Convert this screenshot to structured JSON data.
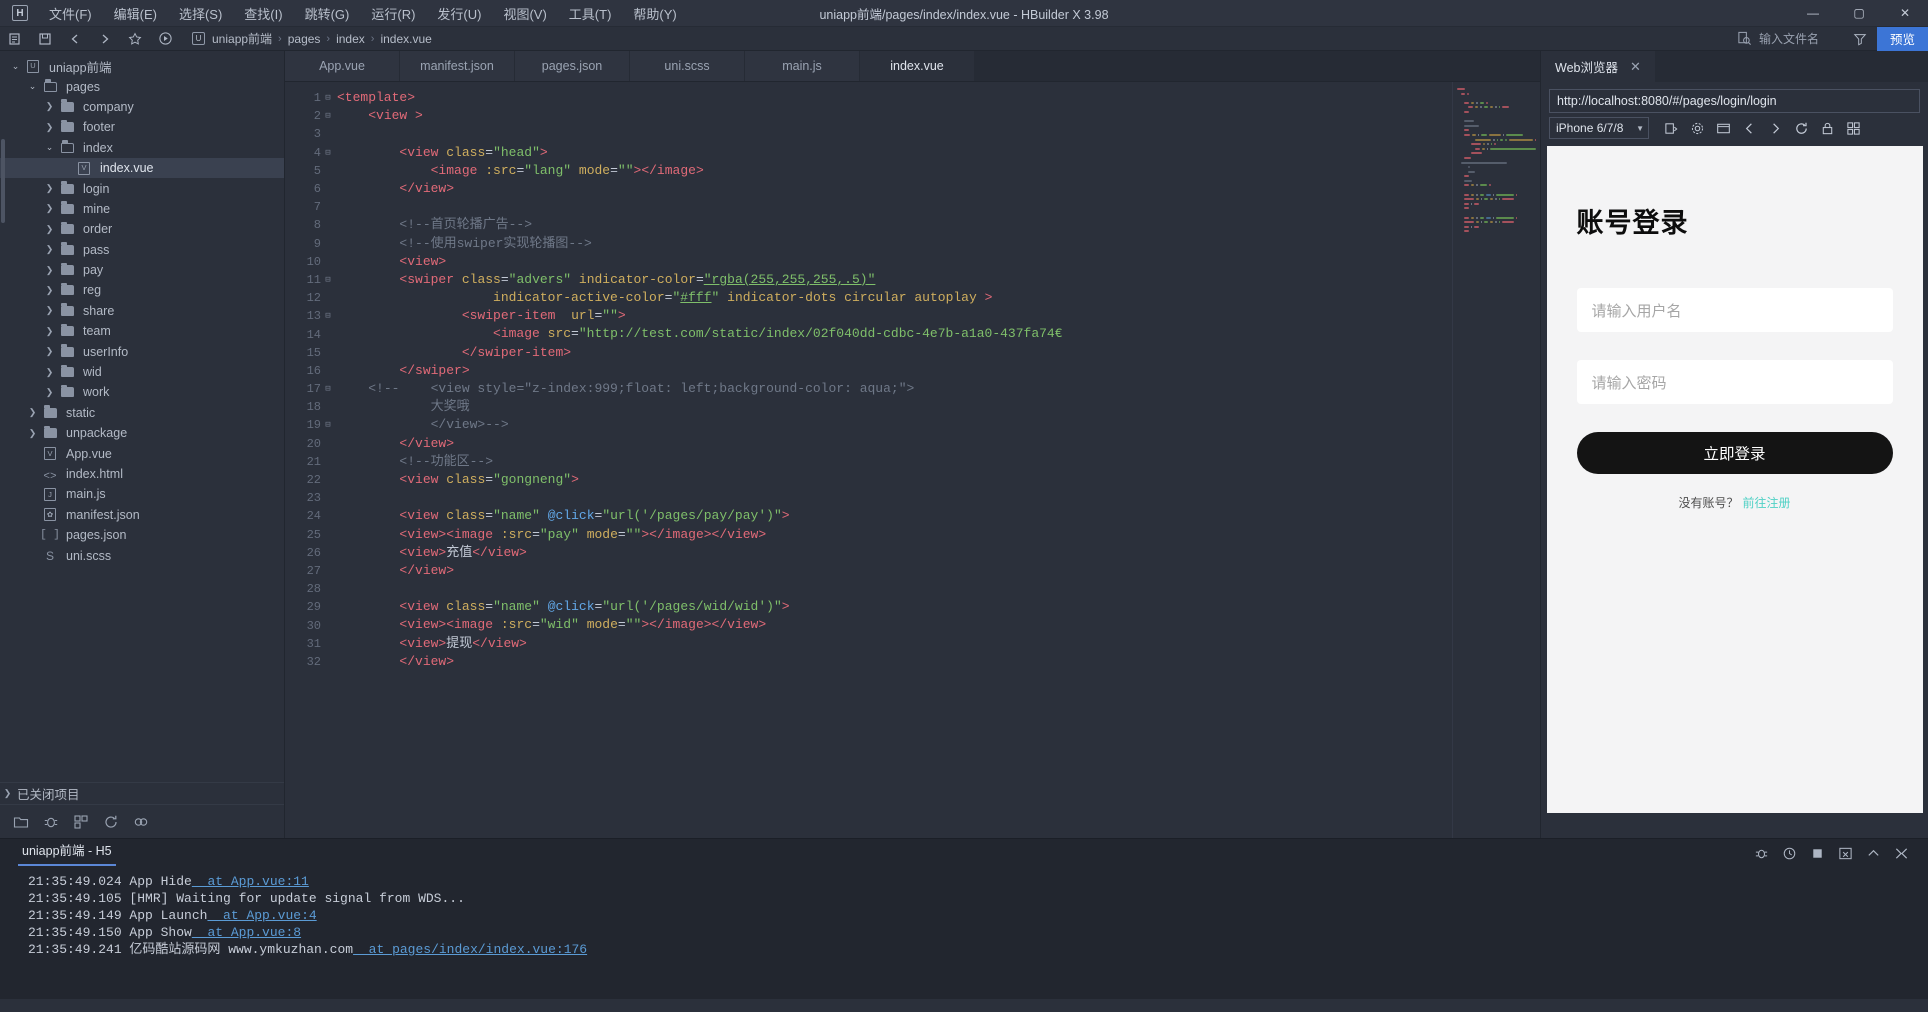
{
  "window": {
    "title": "uniapp前端/pages/index/index.vue - HBuilder X 3.98",
    "logo": "H",
    "minimize": "—",
    "maximize": "▢",
    "close": "✕"
  },
  "menubar": {
    "items": [
      {
        "label": "文件(F)",
        "name": "menu-file"
      },
      {
        "label": "编辑(E)",
        "name": "menu-edit"
      },
      {
        "label": "选择(S)",
        "name": "menu-select"
      },
      {
        "label": "查找(I)",
        "name": "menu-find"
      },
      {
        "label": "跳转(G)",
        "name": "menu-goto"
      },
      {
        "label": "运行(R)",
        "name": "menu-run"
      },
      {
        "label": "发行(U)",
        "name": "menu-publish"
      },
      {
        "label": "视图(V)",
        "name": "menu-view"
      },
      {
        "label": "工具(T)",
        "name": "menu-tools"
      },
      {
        "label": "帮助(Y)",
        "name": "menu-help"
      }
    ]
  },
  "toolbar": {
    "breadcrumb": [
      "uniapp前端",
      "pages",
      "index",
      "index.vue"
    ],
    "breadcrumb_project_icon": "U",
    "file_search_placeholder": "输入文件名",
    "preview_label": "预览",
    "separator": "›"
  },
  "sidebar": {
    "tree": [
      {
        "label": "uniapp前端",
        "depth": 0,
        "caret": "open",
        "icon": "project",
        "selected": false
      },
      {
        "label": "pages",
        "depth": 1,
        "caret": "open",
        "icon": "folder-open",
        "selected": false
      },
      {
        "label": "company",
        "depth": 2,
        "caret": "closed",
        "icon": "folder",
        "selected": false
      },
      {
        "label": "footer",
        "depth": 2,
        "caret": "closed",
        "icon": "folder",
        "selected": false
      },
      {
        "label": "index",
        "depth": 2,
        "caret": "open",
        "icon": "folder-open",
        "selected": false
      },
      {
        "label": "index.vue",
        "depth": 3,
        "caret": "none",
        "icon": "vue",
        "selected": true
      },
      {
        "label": "login",
        "depth": 2,
        "caret": "closed",
        "icon": "folder",
        "selected": false
      },
      {
        "label": "mine",
        "depth": 2,
        "caret": "closed",
        "icon": "folder",
        "selected": false
      },
      {
        "label": "order",
        "depth": 2,
        "caret": "closed",
        "icon": "folder",
        "selected": false
      },
      {
        "label": "pass",
        "depth": 2,
        "caret": "closed",
        "icon": "folder",
        "selected": false
      },
      {
        "label": "pay",
        "depth": 2,
        "caret": "closed",
        "icon": "folder",
        "selected": false
      },
      {
        "label": "reg",
        "depth": 2,
        "caret": "closed",
        "icon": "folder",
        "selected": false
      },
      {
        "label": "share",
        "depth": 2,
        "caret": "closed",
        "icon": "folder",
        "selected": false
      },
      {
        "label": "team",
        "depth": 2,
        "caret": "closed",
        "icon": "folder",
        "selected": false
      },
      {
        "label": "userInfo",
        "depth": 2,
        "caret": "closed",
        "icon": "folder",
        "selected": false
      },
      {
        "label": "wid",
        "depth": 2,
        "caret": "closed",
        "icon": "folder",
        "selected": false
      },
      {
        "label": "work",
        "depth": 2,
        "caret": "closed",
        "icon": "folder",
        "selected": false
      },
      {
        "label": "static",
        "depth": 1,
        "caret": "closed",
        "icon": "folder",
        "selected": false
      },
      {
        "label": "unpackage",
        "depth": 1,
        "caret": "closed",
        "icon": "folder",
        "selected": false
      },
      {
        "label": "App.vue",
        "depth": 1,
        "caret": "none",
        "icon": "vue",
        "selected": false
      },
      {
        "label": "index.html",
        "depth": 1,
        "caret": "none",
        "icon": "html",
        "selected": false
      },
      {
        "label": "main.js",
        "depth": 1,
        "caret": "none",
        "icon": "js",
        "selected": false
      },
      {
        "label": "manifest.json",
        "depth": 1,
        "caret": "none",
        "icon": "cfg",
        "selected": false
      },
      {
        "label": "pages.json",
        "depth": 1,
        "caret": "none",
        "icon": "json",
        "selected": false
      },
      {
        "label": "uni.scss",
        "depth": 1,
        "caret": "none",
        "icon": "scss",
        "selected": false
      }
    ],
    "closed_projects": "已关闭项目",
    "bottom_icons": [
      "explorer-icon",
      "debug-icon",
      "plugin-icon",
      "refresh-icon",
      "sync-icon"
    ]
  },
  "editor": {
    "tabs": [
      {
        "label": "App.vue",
        "active": false
      },
      {
        "label": "manifest.json",
        "active": false
      },
      {
        "label": "pages.json",
        "active": false
      },
      {
        "label": "uni.scss",
        "active": false
      },
      {
        "label": "main.js",
        "active": false
      },
      {
        "label": "index.vue",
        "active": true
      }
    ],
    "lines": [
      {
        "n": 1,
        "fold": "-",
        "html": "<span class=\"tag\">&lt;template&gt;</span>"
      },
      {
        "n": 2,
        "fold": "-",
        "html": "    <span class=\"tag\">&lt;view </span><span class=\"tag\">&gt;</span>"
      },
      {
        "n": 3,
        "fold": "",
        "html": ""
      },
      {
        "n": 4,
        "fold": "-",
        "html": "        <span class=\"tag\">&lt;view </span><span class=\"attr\">class</span><span class=\"plain\">=</span><span class=\"str\">\"head\"</span><span class=\"tag\">&gt;</span>"
      },
      {
        "n": 5,
        "fold": "",
        "html": "            <span class=\"tag\">&lt;image </span><span class=\"attr\">:src</span><span class=\"plain\">=</span><span class=\"str\">\"lang\"</span> <span class=\"attr\">mode</span><span class=\"plain\">=</span><span class=\"str\">\"\"</span><span class=\"tag\">&gt;&lt;/image&gt;</span>"
      },
      {
        "n": 6,
        "fold": "",
        "html": "        <span class=\"tag\">&lt;/view&gt;</span>"
      },
      {
        "n": 7,
        "fold": "",
        "html": ""
      },
      {
        "n": 8,
        "fold": "",
        "html": "        <span class=\"cmt\">&lt;!--首页轮播广告--&gt;</span>"
      },
      {
        "n": 9,
        "fold": "",
        "html": "        <span class=\"cmt\">&lt;!--使用swiper实现轮播图--&gt;</span>"
      },
      {
        "n": 10,
        "fold": "",
        "html": "        <span class=\"tag\">&lt;view&gt;</span>"
      },
      {
        "n": 11,
        "fold": "-",
        "html": "        <span class=\"tag\">&lt;swiper </span><span class=\"attr\">class</span><span class=\"plain\">=</span><span class=\"str\">\"advers\"</span> <span class=\"attr\">indicator-color</span><span class=\"plain\">=</span><span class=\"str ul\">\"rgba(255,255,255,.5)\"</span>"
      },
      {
        "n": 12,
        "fold": "",
        "html": "                    <span class=\"attr\">indicator-active-color</span><span class=\"plain\">=</span><span class=\"str\">\"</span><span class=\"str ul\">#fff</span><span class=\"str\">\"</span> <span class=\"attr\">indicator-dots circular autoplay</span> <span class=\"tag\">&gt;</span>"
      },
      {
        "n": 13,
        "fold": "-",
        "html": "                <span class=\"tag\">&lt;swiper-item </span> <span class=\"attr\">url</span><span class=\"plain\">=</span><span class=\"str\">\"\"</span><span class=\"tag\">&gt;</span>"
      },
      {
        "n": 14,
        "fold": "",
        "html": "                    <span class=\"tag\">&lt;image </span><span class=\"attr\">src</span><span class=\"plain\">=</span><span class=\"str\">\"http://test.com/static/index/02f040dd-cdbc-4e7b-a1a0-437fa74€</span>"
      },
      {
        "n": 15,
        "fold": "",
        "html": "                <span class=\"tag\">&lt;/swiper-item&gt;</span>"
      },
      {
        "n": 16,
        "fold": "",
        "html": "        <span class=\"tag\">&lt;/swiper&gt;</span>"
      },
      {
        "n": 17,
        "fold": "-",
        "html": "    <span class=\"cmt\">&lt;!--    &lt;view style=\"z-index:999;float: left;background-color: aqua;\"&gt;</span>"
      },
      {
        "n": 18,
        "fold": "",
        "html": "            <span class=\"cmt\">大奖哦</span>"
      },
      {
        "n": 19,
        "fold": "-",
        "html": "            <span class=\"cmt\">&lt;/view&gt;--&gt;</span>"
      },
      {
        "n": 20,
        "fold": "",
        "html": "        <span class=\"tag\">&lt;/view&gt;</span>"
      },
      {
        "n": 21,
        "fold": "",
        "html": "        <span class=\"cmt\">&lt;!--功能区--&gt;</span>"
      },
      {
        "n": 22,
        "fold": "",
        "html": "        <span class=\"tag\">&lt;view </span><span class=\"attr\">class</span><span class=\"plain\">=</span><span class=\"str\">\"gongneng\"</span><span class=\"tag\">&gt;</span>"
      },
      {
        "n": 23,
        "fold": "",
        "html": ""
      },
      {
        "n": 24,
        "fold": "",
        "html": "        <span class=\"tag\">&lt;view </span><span class=\"attr\">class</span><span class=\"plain\">=</span><span class=\"str\">\"name\"</span> <span class=\"evt\">@click</span><span class=\"plain\">=</span><span class=\"str\">\"url('/pages/pay/pay')\"</span><span class=\"tag\">&gt;</span>"
      },
      {
        "n": 25,
        "fold": "",
        "html": "        <span class=\"tag\">&lt;view&gt;&lt;image </span><span class=\"attr\">:src</span><span class=\"plain\">=</span><span class=\"str\">\"pay\"</span> <span class=\"attr\">mode</span><span class=\"plain\">=</span><span class=\"str\">\"\"</span><span class=\"tag\">&gt;&lt;/image&gt;&lt;/view&gt;</span>"
      },
      {
        "n": 26,
        "fold": "",
        "html": "        <span class=\"tag\">&lt;view&gt;</span><span class=\"txt\">充值</span><span class=\"tag\">&lt;/view&gt;</span>"
      },
      {
        "n": 27,
        "fold": "",
        "html": "        <span class=\"tag\">&lt;/view&gt;</span>"
      },
      {
        "n": 28,
        "fold": "",
        "html": ""
      },
      {
        "n": 29,
        "fold": "",
        "html": "        <span class=\"tag\">&lt;view </span><span class=\"attr\">class</span><span class=\"plain\">=</span><span class=\"str\">\"name\"</span> <span class=\"evt\">@click</span><span class=\"plain\">=</span><span class=\"str\">\"url('/pages/wid/wid')\"</span><span class=\"tag\">&gt;</span>"
      },
      {
        "n": 30,
        "fold": "",
        "html": "        <span class=\"tag\">&lt;view&gt;&lt;image </span><span class=\"attr\">:src</span><span class=\"plain\">=</span><span class=\"str\">\"wid\"</span> <span class=\"attr\">mode</span><span class=\"plain\">=</span><span class=\"str\">\"\"</span><span class=\"tag\">&gt;&lt;/image&gt;&lt;/view&gt;</span>"
      },
      {
        "n": 31,
        "fold": "",
        "html": "        <span class=\"tag\">&lt;view&gt;</span><span class=\"txt\">提现</span><span class=\"tag\">&lt;/view&gt;</span>"
      },
      {
        "n": 32,
        "fold": "",
        "html": "        <span class=\"tag\">&lt;/view&gt;</span>"
      }
    ]
  },
  "browser": {
    "tab_label": "Web浏览器",
    "close_label": "✕",
    "url": "http://localhost:8080/#/pages/login/login",
    "device": "iPhone 6/7/8",
    "toolbar_icons": [
      "rotate-icon",
      "settings-icon",
      "screenshot-icon",
      "back-icon",
      "forward-icon",
      "reload-icon",
      "lock-icon",
      "grid-icon"
    ],
    "preview": {
      "title": "账号登录",
      "username_placeholder": "请输入用户名",
      "password_placeholder": "请输入密码",
      "login_button": "立即登录",
      "footer_text": "没有账号？",
      "footer_link": "前往注册",
      "accent_color": "#4fd1c5",
      "button_color": "#141414"
    }
  },
  "console": {
    "tab_label": "uniapp前端 - H5",
    "icons": [
      "bug-icon",
      "clock-icon",
      "stop-icon",
      "clear-icon",
      "collapse-icon",
      "close-all-icon"
    ],
    "rows": [
      {
        "time": "21:35:49.024",
        "msg": "App Hide",
        "link": "at App.vue:11"
      },
      {
        "time": "21:35:49.105",
        "msg": "[HMR] Waiting for update signal from WDS...",
        "link": ""
      },
      {
        "time": "21:35:49.149",
        "msg": "App Launch",
        "link": "at App.vue:4"
      },
      {
        "time": "21:35:49.150",
        "msg": "App Show",
        "link": "at App.vue:8"
      },
      {
        "time": "21:35:49.241",
        "msg": "亿码酷站源码网 www.ymkuzhan.com",
        "link": "at pages/index/index.vue:176"
      }
    ]
  }
}
